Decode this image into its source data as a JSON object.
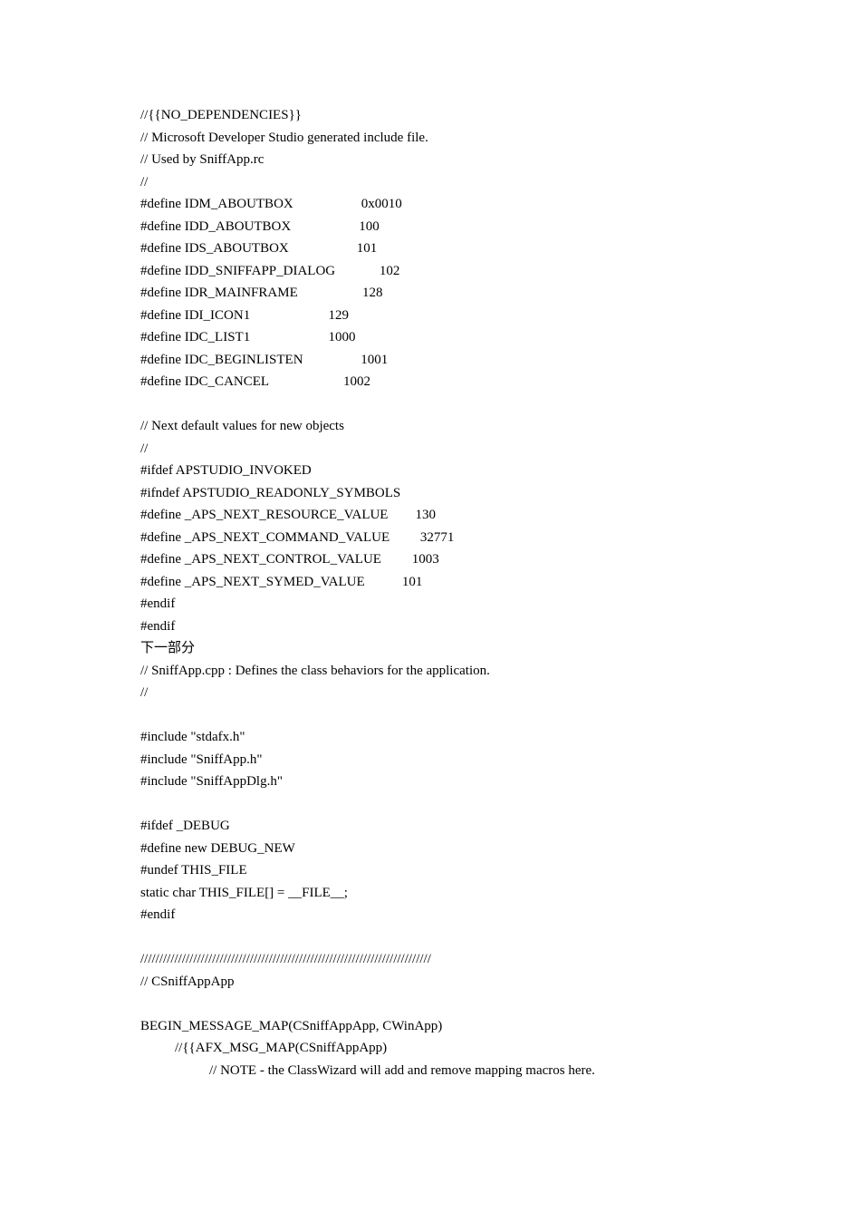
{
  "code": {
    "l1": "//{{NO_DEPENDENCIES}}",
    "l2": "// Microsoft Developer Studio generated include file.",
    "l3": "// Used by SniffApp.rc",
    "l4": "//",
    "l5": "#define IDM_ABOUTBOX                    0x0010",
    "l6": "#define IDD_ABOUTBOX                    100",
    "l7": "#define IDS_ABOUTBOX                    101",
    "l8": "#define IDD_SNIFFAPP_DIALOG             102",
    "l9": "#define IDR_MAINFRAME                   128",
    "l10": "#define IDI_ICON1                       129",
    "l11": "#define IDC_LIST1                       1000",
    "l12": "#define IDC_BEGINLISTEN                 1001",
    "l13": "#define IDC_CANCEL                      1002",
    "l14": "// Next default values for new objects",
    "l15": "//",
    "l16": "#ifdef APSTUDIO_INVOKED",
    "l17": "#ifndef APSTUDIO_READONLY_SYMBOLS",
    "l18": "#define _APS_NEXT_RESOURCE_VALUE        130",
    "l19": "#define _APS_NEXT_COMMAND_VALUE         32771",
    "l20": "#define _APS_NEXT_CONTROL_VALUE         1003",
    "l21": "#define _APS_NEXT_SYMED_VALUE           101",
    "l22": "#endif",
    "l23": "#endif",
    "l24": "下一部分",
    "l25": "// SniffApp.cpp : Defines the class behaviors for the application.",
    "l26": "//",
    "l27": "#include \"stdafx.h\"",
    "l28": "#include \"SniffApp.h\"",
    "l29": "#include \"SniffAppDlg.h\"",
    "l30": "#ifdef _DEBUG",
    "l31": "#define new DEBUG_NEW",
    "l32": "#undef THIS_FILE",
    "l33": "static char THIS_FILE[] = __FILE__;",
    "l34": "#endif",
    "l35": "/////////////////////////////////////////////////////////////////////////////",
    "l36": "// CSniffAppApp",
    "l37": "BEGIN_MESSAGE_MAP(CSniffAppApp, CWinApp)",
    "l38": "//{{AFX_MSG_MAP(CSniffAppApp)",
    "l39": "// NOTE - the ClassWizard will add and remove mapping macros here."
  }
}
